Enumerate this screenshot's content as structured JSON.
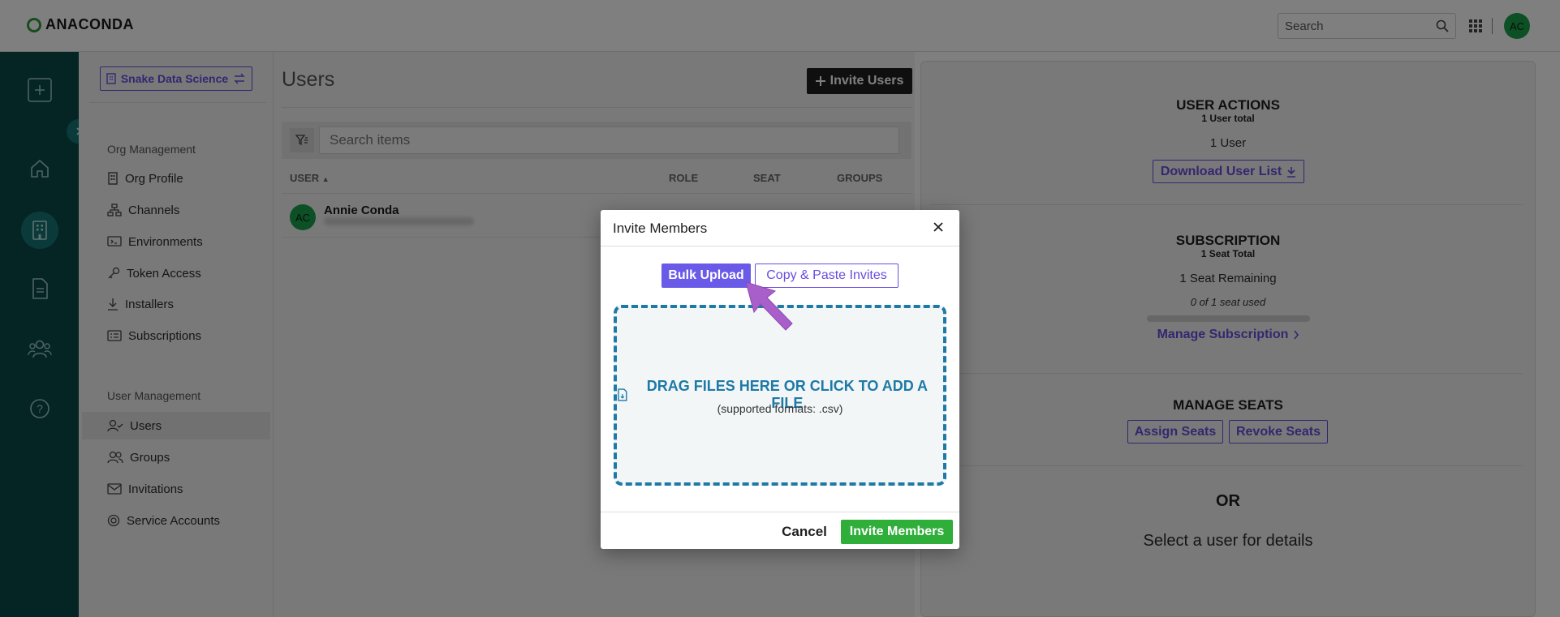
{
  "app": {
    "logo_text": "ANACONDA"
  },
  "topbar": {
    "search_placeholder": "Search",
    "avatar_initials": "AC"
  },
  "rail": {
    "icons": [
      "plus-icon",
      "home-icon",
      "building-icon",
      "document-icon",
      "people-icon",
      "help-icon"
    ],
    "active": "building-icon"
  },
  "sidebar": {
    "org_button_label": "Snake Data Science",
    "org_section": "Org Management",
    "org_items": [
      {
        "label": "Org Profile",
        "icon": "building-icon"
      },
      {
        "label": "Channels",
        "icon": "channels-icon"
      },
      {
        "label": "Environments",
        "icon": "environment-icon"
      },
      {
        "label": "Token Access",
        "icon": "key-icon"
      },
      {
        "label": "Installers",
        "icon": "download-icon"
      },
      {
        "label": "Subscriptions",
        "icon": "list-icon"
      }
    ],
    "user_section": "User Management",
    "user_items": [
      {
        "label": "Users",
        "icon": "user-check-icon",
        "active": true
      },
      {
        "label": "Groups",
        "icon": "group-icon"
      },
      {
        "label": "Invitations",
        "icon": "mail-icon"
      },
      {
        "label": "Service Accounts",
        "icon": "service-account-icon"
      }
    ]
  },
  "main": {
    "title": "Users",
    "invite_button": "Invite Users",
    "search_placeholder": "Search items",
    "columns": [
      "USER",
      "ROLE",
      "SEAT",
      "GROUPS"
    ],
    "rows": [
      {
        "initials": "AC",
        "name": "Annie Conda"
      }
    ]
  },
  "details": {
    "user_actions": {
      "title": "USER ACTIONS",
      "subtitle": "1 User total",
      "count": "1 User",
      "download": "Download User List"
    },
    "subscription": {
      "title": "SUBSCRIPTION",
      "subtitle": "1 Seat Total",
      "remaining": "1 Seat Remaining",
      "used": "0 of 1 seat used",
      "used_fraction": 0,
      "manage": "Manage Subscription"
    },
    "manage_seats": {
      "title": "MANAGE SEATS",
      "assign": "Assign Seats",
      "revoke": "Revoke Seats"
    },
    "or_text": "OR",
    "select_text": "Select a user for details"
  },
  "modal": {
    "title": "Invite Members",
    "tab_bulk": "Bulk Upload",
    "tab_copy": "Copy & Paste Invites",
    "drop_text": "DRAG FILES HERE OR CLICK TO ADD A FILE",
    "drop_sub": "(supported formats: .csv)",
    "cancel": "Cancel",
    "submit": "Invite Members"
  },
  "colors": {
    "accent": "#6a4de0",
    "brand_green": "#2fae3a",
    "rail": "#0a4a4a",
    "drop": "#1e79a6",
    "annotation_arrow": "#a95fc9"
  }
}
